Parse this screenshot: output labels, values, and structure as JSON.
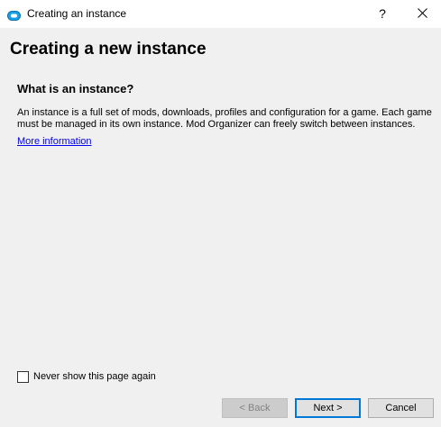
{
  "window": {
    "title": "Creating an instance",
    "help_label": "?"
  },
  "icons": {
    "app": "mod-organizer-icon",
    "close": "close-icon"
  },
  "page": {
    "heading": "Creating a new instance",
    "section_title": "What is an instance?",
    "description": "An instance is a full set of mods, downloads, profiles and configuration for a game. Each game must be managed in its own instance. Mod Organizer can freely switch between instances.",
    "more_info_link": "More information"
  },
  "footer": {
    "never_show_label": "Never show this page again",
    "never_show_checked": false,
    "back_label": "< Back",
    "back_enabled": false,
    "next_label": "Next >",
    "cancel_label": "Cancel"
  },
  "colors": {
    "window_bg": "#f0f0f0",
    "titlebar_bg": "#ffffff",
    "link": "#0000ee",
    "focus_border": "#0078d7",
    "app_icon": "#1aa0e6"
  }
}
